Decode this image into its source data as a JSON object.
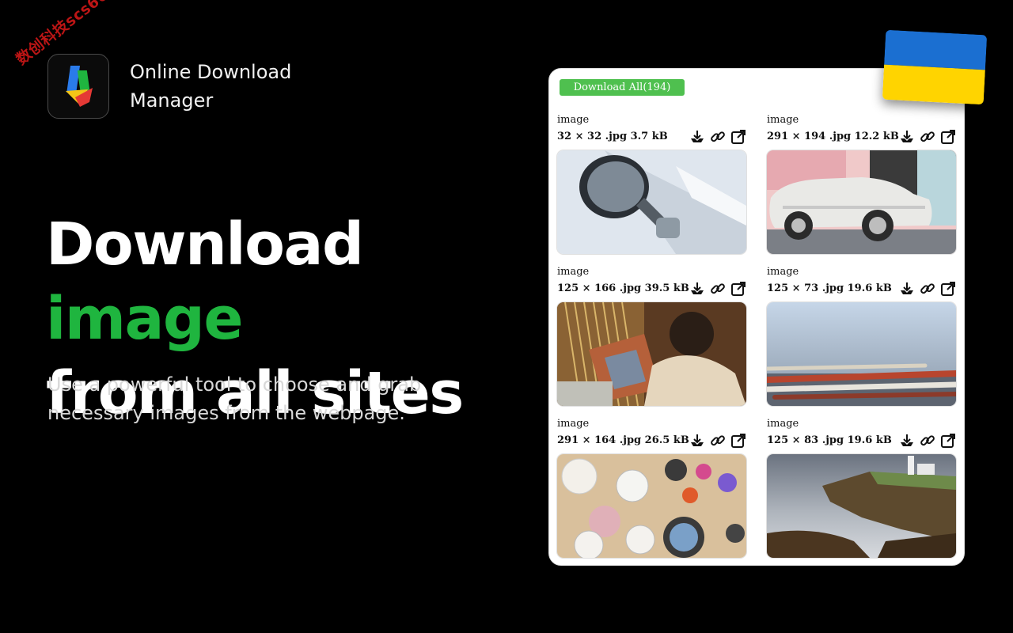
{
  "watermark": "数创科技scs66",
  "app": {
    "name": "Online Download Manager"
  },
  "hero": {
    "headline_part1": "Download",
    "headline_accent": "image",
    "headline_part2": "from all sites",
    "subtext": "Use a powerful tool to choose and grab necessary images from the webpage."
  },
  "panel": {
    "download_all_label": "Download All(194)",
    "cards": [
      {
        "title": "image",
        "meta": "32 × 32  .jpg  3.7 kB"
      },
      {
        "title": "image",
        "meta": "291 × 194  .jpg  12.2 kB"
      },
      {
        "title": "image",
        "meta": "125 × 166  .jpg  39.5 kB"
      },
      {
        "title": "image",
        "meta": "125 × 73  .jpg  19.6 kB"
      },
      {
        "title": "image",
        "meta": "291 × 164  .jpg  26.5 kB"
      },
      {
        "title": "image",
        "meta": "125 × 83  .jpg  19.6 kB"
      }
    ]
  },
  "colors": {
    "accent_green": "#1fb53f",
    "download_all_button": "#4fc04f",
    "flag_blue": "#1b6fd1",
    "flag_yellow": "#ffd400"
  },
  "icons": [
    "download-icon",
    "link-icon",
    "open-external-icon",
    "app-logo-icon",
    "ukraine-flag"
  ]
}
